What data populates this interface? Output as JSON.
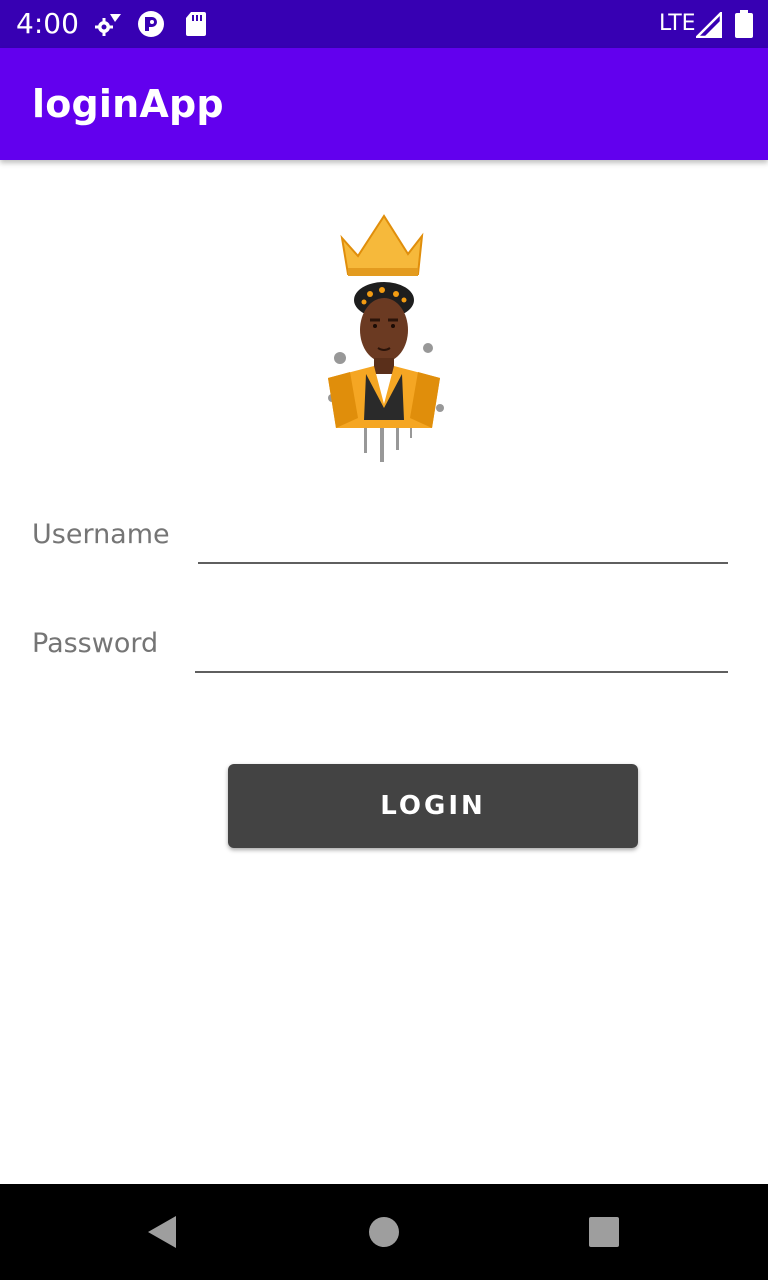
{
  "status_bar": {
    "time": "4:00",
    "network": "LTE",
    "icons": [
      "settings-gear-icon",
      "pocket-casts-icon",
      "sd-card-icon",
      "signal-icon",
      "battery-icon"
    ]
  },
  "app_bar": {
    "title": "loginApp",
    "color": "#6200ee"
  },
  "avatar": {
    "icon": "crowned-king-avatar-icon"
  },
  "form": {
    "username_label": "Username",
    "username_value": "",
    "password_label": "Password",
    "password_value": ""
  },
  "login_button": {
    "label": "LOGIN",
    "color": "#434343"
  },
  "nav_bar": {
    "icons": [
      "back-icon",
      "home-icon",
      "recents-icon"
    ]
  }
}
